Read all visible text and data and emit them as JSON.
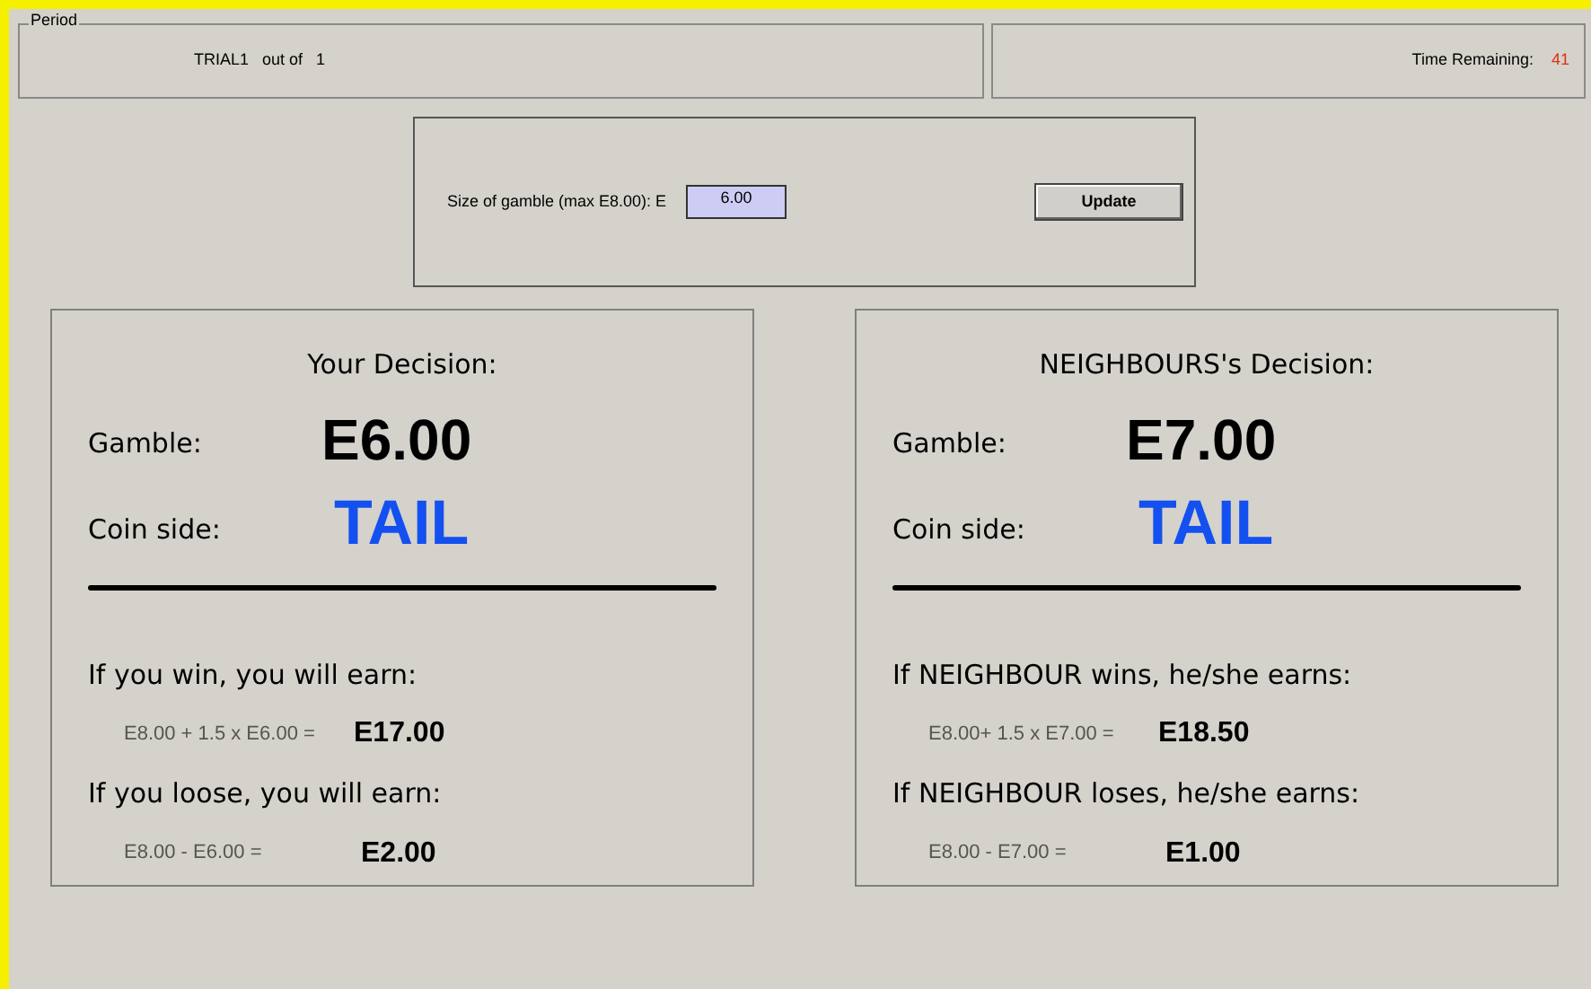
{
  "period": {
    "legend": "Period",
    "trial": "TRIAL1",
    "out_of": "out of",
    "total": "1"
  },
  "timer": {
    "label": "Time Remaining:",
    "value": "41"
  },
  "gamble_form": {
    "label": "Size of gamble (max E8.00): E",
    "value": "6.00",
    "button": "Update"
  },
  "panels": [
    {
      "title": "Your Decision:",
      "gamble_label": "Gamble:",
      "gamble": "E6.00",
      "coin_label": "Coin side:",
      "coin": "TAIL",
      "outcomes": [
        {
          "label": "If you win, you will earn:",
          "formula": "E8.00 + 1.5 x E6.00 =",
          "amount": "E17.00"
        },
        {
          "label": "If you loose, you will earn:",
          "formula": "E8.00 - E6.00 =",
          "amount": "E2.00"
        }
      ]
    },
    {
      "title": "NEIGHBOURS's Decision:",
      "gamble_label": "Gamble:",
      "gamble": "E7.00",
      "coin_label": "Coin side:",
      "coin": "TAIL",
      "outcomes": [
        {
          "label": "If NEIGHBOUR wins, he/she earns:",
          "formula": "E8.00+ 1.5 x E7.00 =",
          "amount": "E18.50"
        },
        {
          "label": "If NEIGHBOUR loses, he/she earns:",
          "formula": "E8.00 - E7.00 =",
          "amount": "E1.00"
        }
      ]
    }
  ]
}
